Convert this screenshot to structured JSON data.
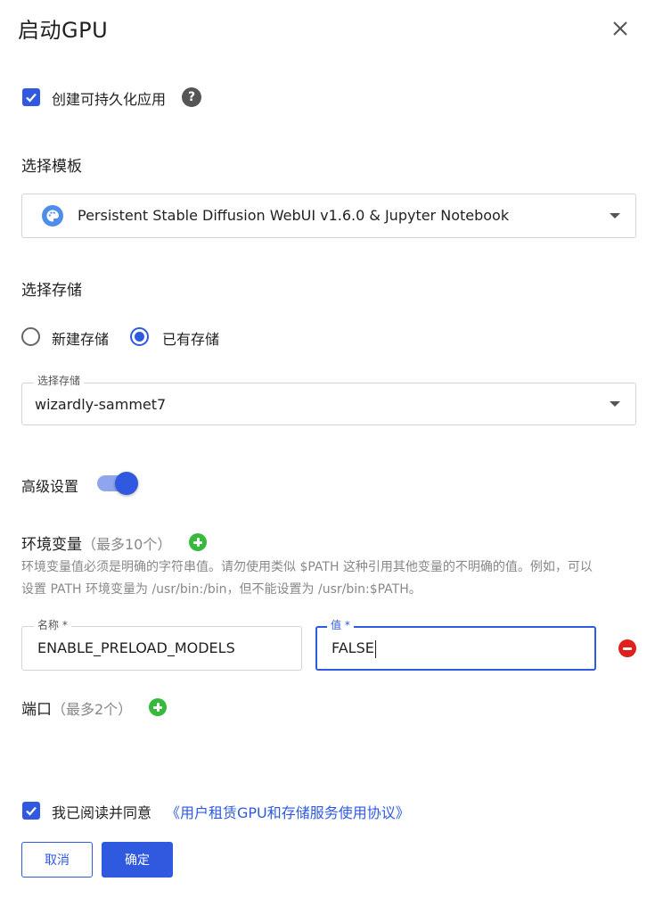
{
  "dialog": {
    "title": "启动GPU",
    "close_icon": "close-icon"
  },
  "persistent": {
    "checked": true,
    "label": "创建可持久化应用",
    "help": "?"
  },
  "template": {
    "section_title": "选择模板",
    "selected": "Persistent Stable Diffusion WebUI v1.6.0 & Jupyter Notebook",
    "icon": "palette-icon"
  },
  "storage": {
    "section_title": "选择存储",
    "options": [
      {
        "label": "新建存储",
        "selected": false
      },
      {
        "label": "已有存储",
        "selected": true
      }
    ],
    "select_label": "选择存储",
    "selected": "wizardly-sammet7"
  },
  "advanced": {
    "label": "高级设置",
    "enabled": true
  },
  "env": {
    "title": "环境变量",
    "limit": "（最多10个）",
    "hint_line1": "环境变量值必须是明确的字符串值。请勿使用类似 $PATH 这种引用其他变量的不明确的值。例如，可以",
    "hint_line2": "设置 PATH 环境变量为 /usr/bin:/bin，但不能设置为 /usr/bin:$PATH。",
    "name_label": "名称 *",
    "name_value": "ENABLE_PRELOAD_MODELS",
    "value_label": "值 *",
    "value_value": "FALSE"
  },
  "ports": {
    "title": "端口",
    "limit": "（最多2个）"
  },
  "agreement": {
    "checked": true,
    "text": "我已阅读并同意",
    "link": "《用户租赁GPU和存储服务使用协议》"
  },
  "footer": {
    "cancel": "取消",
    "confirm": "确定"
  },
  "colors": {
    "accent": "#2f5ae0",
    "add": "#36b93c",
    "remove": "#e0201c"
  }
}
